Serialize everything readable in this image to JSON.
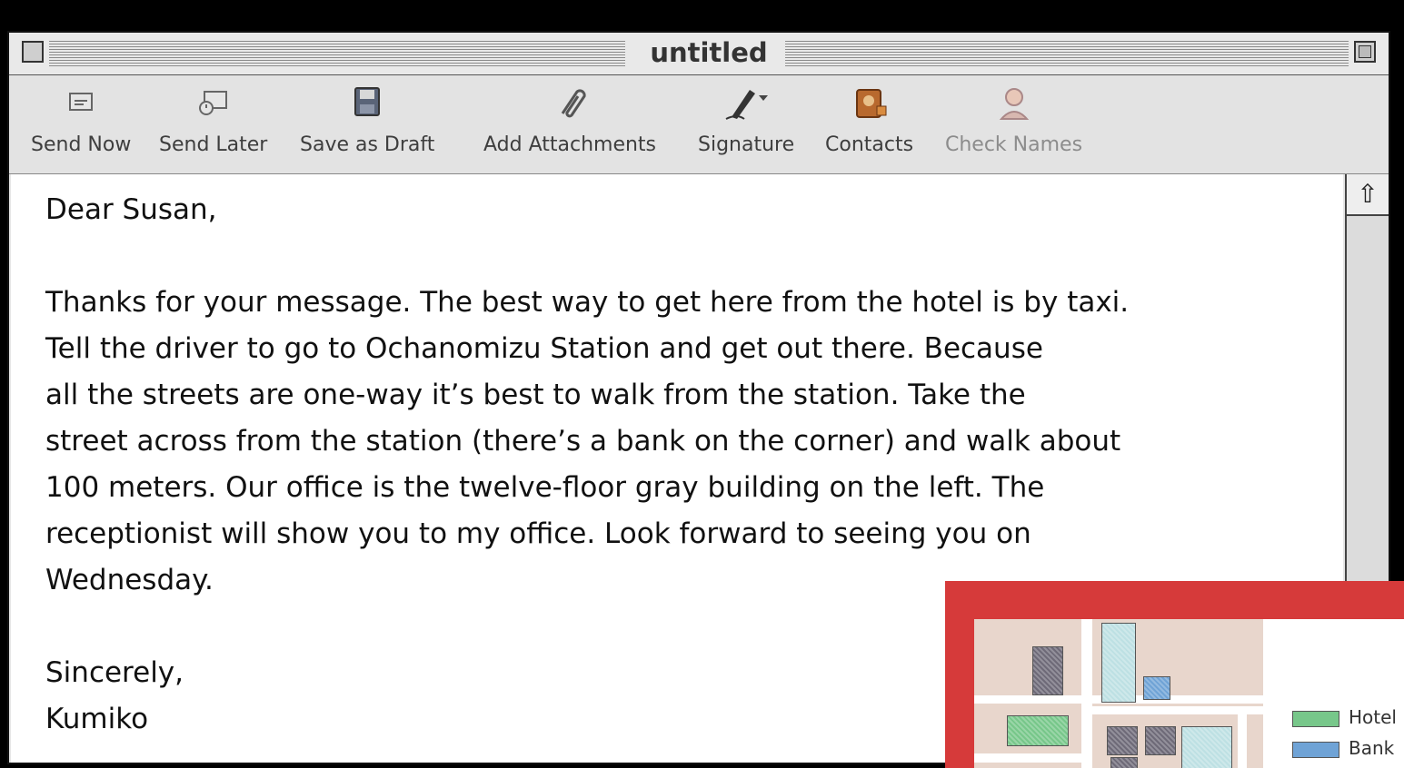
{
  "window": {
    "title": "untitled"
  },
  "toolbar": {
    "items": [
      {
        "label": "Send Now",
        "icon": "send-now-icon"
      },
      {
        "label": "Send Later",
        "icon": "send-later-icon"
      },
      {
        "label": "Save as Draft",
        "icon": "floppy-disk-icon"
      },
      {
        "label": "Add Attachments",
        "icon": "paperclip-icon"
      },
      {
        "label": "Signature",
        "icon": "pen-icon"
      },
      {
        "label": "Contacts",
        "icon": "contacts-icon"
      },
      {
        "label": "Check Names",
        "icon": "check-names-icon"
      }
    ]
  },
  "message": {
    "greeting": "Dear Susan,",
    "body_lines": [
      "Thanks for your message. The best way to get here from the hotel is by taxi.",
      "Tell the driver to go to Ochanomizu Station and get out there. Because",
      "all the streets are one-way it’s best to walk from the station. Take the",
      "street across from the station (there’s a bank on the corner) and walk about",
      "100 meters. Our office is the twelve-floor gray building on the left. The",
      "receptionist will show you to my office. Look forward to seeing you on",
      "Wednesday."
    ],
    "closing": "Sincerely,",
    "signature": "Kumiko"
  },
  "map_legend": [
    {
      "label": "Hotel",
      "color": "#77c78a"
    },
    {
      "label": "Bank",
      "color": "#6fa3d6"
    }
  ],
  "colors": {
    "map_panel_border": "#d63a3a",
    "gray_building": "#6e6a78",
    "light_building": "#bde0e3"
  }
}
